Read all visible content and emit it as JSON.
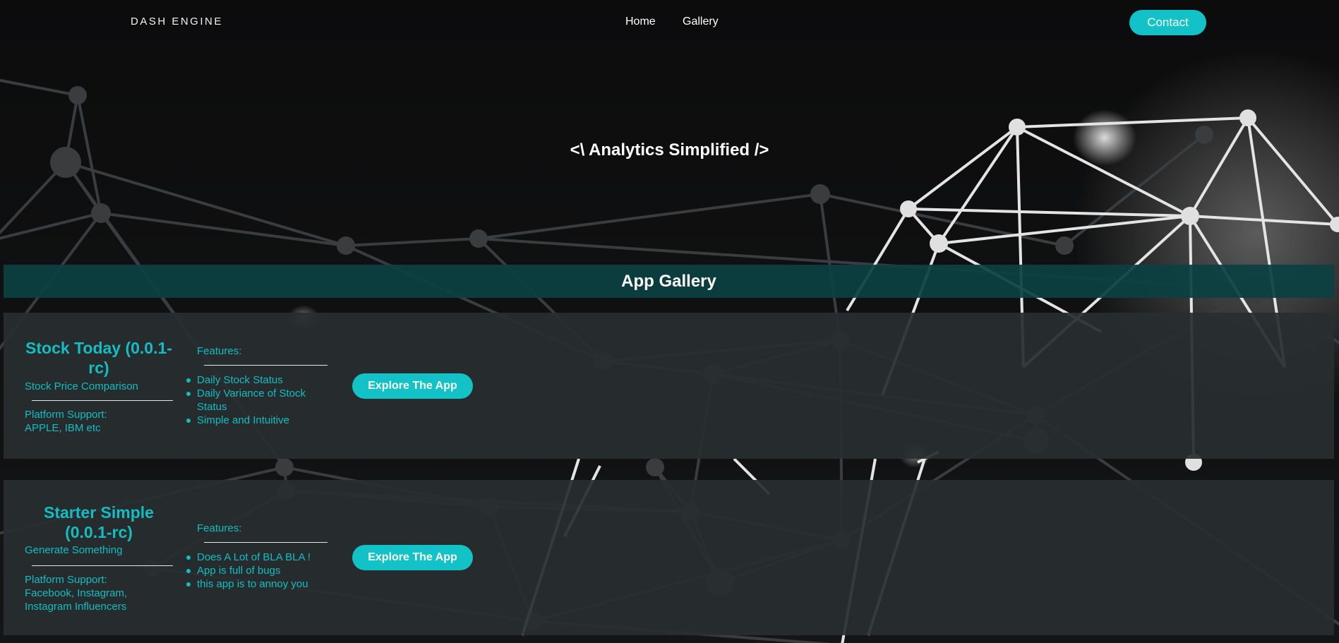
{
  "nav": {
    "brand": "DASH ENGINE",
    "links": [
      {
        "label": "Home"
      },
      {
        "label": "Gallery"
      }
    ],
    "contact_label": "Contact"
  },
  "hero": {
    "title": "<\\ Analytics Simplified />"
  },
  "gallery": {
    "heading": "App Gallery",
    "features_label": "Features:",
    "explore_label": "Explore The App",
    "apps": [
      {
        "title": "Stock Today (0.0.1-rc)",
        "subtitle": "Stock Price Comparison",
        "platform_label": "Platform Support:",
        "platform_value": "APPLE, IBM etc",
        "features": [
          "Daily Stock Status",
          "Daily Variance of Stock Status",
          "Simple and Intuitive"
        ]
      },
      {
        "title": "Starter Simple (0.0.1-rc)",
        "subtitle": "Generate Something",
        "platform_label": "Platform Support:",
        "platform_value": "Facebook, Instagram, Instagram Influencers",
        "features": [
          "Does A Lot of BLA BLA !",
          "App is full of bugs",
          "this app is to annoy you"
        ]
      }
    ]
  },
  "colors": {
    "accent": "#12c2c6",
    "teal_text": "#13bdc1",
    "gallery_bar": "#0b4042",
    "card": "#282e30",
    "background": "#111213"
  }
}
